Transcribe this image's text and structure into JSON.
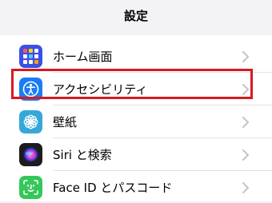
{
  "nav": {
    "title": "設定"
  },
  "rows": [
    {
      "label": "ホーム画面",
      "icon": "home-screen-icon",
      "color": "#3d5afe"
    },
    {
      "label": "アクセシビリティ",
      "icon": "accessibility-icon",
      "color": "#1a7cf5"
    },
    {
      "label": "壁紙",
      "icon": "wallpaper-icon",
      "color": "#34aadc"
    },
    {
      "label": "Siri と検索",
      "icon": "siri-icon",
      "color": "#222222"
    },
    {
      "label": "Face ID とパスコード",
      "icon": "face-id-icon",
      "color": "#34c759"
    }
  ],
  "highlight": {
    "color": "#d71920"
  }
}
